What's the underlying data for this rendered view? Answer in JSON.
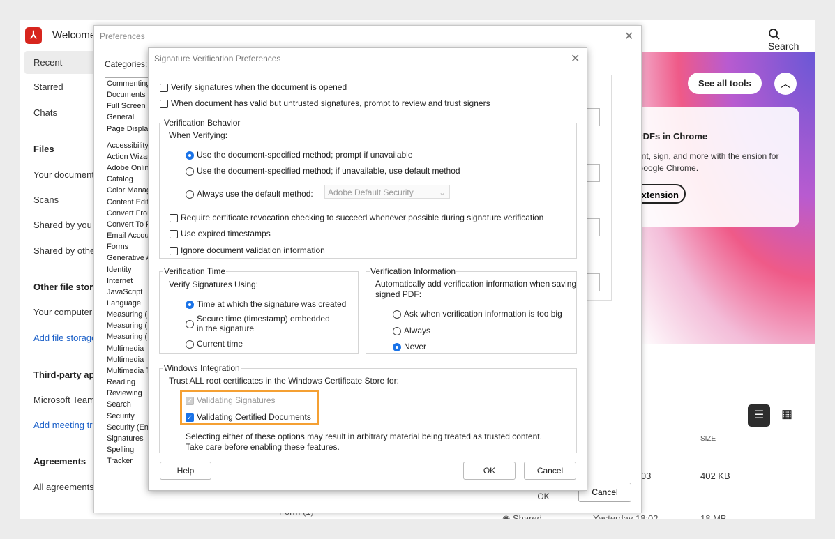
{
  "app": {
    "welcome": "Welcome",
    "search_label": "Search",
    "sidebar": [
      {
        "label": "Recent",
        "type": "item",
        "selected": true
      },
      {
        "label": "Starred",
        "type": "item"
      },
      {
        "label": "Chats",
        "type": "item"
      },
      {
        "label": "Files",
        "type": "head"
      },
      {
        "label": "Your document",
        "type": "item"
      },
      {
        "label": "Scans",
        "type": "item"
      },
      {
        "label": "Shared by you",
        "type": "item"
      },
      {
        "label": "Shared by othe",
        "type": "item"
      },
      {
        "label": "Other file stora",
        "type": "head"
      },
      {
        "label": "Your computer",
        "type": "item"
      },
      {
        "label": "Add file storage",
        "type": "link"
      },
      {
        "label": "Third-party app",
        "type": "head"
      },
      {
        "label": "Microsoft Team",
        "type": "item"
      },
      {
        "label": "Add meeting tr",
        "type": "link"
      },
      {
        "label": "Agreements",
        "type": "head"
      },
      {
        "label": "All agreements",
        "type": "item"
      }
    ],
    "see_all_tools": "See all tools",
    "promo_title": "PDFs in Chrome",
    "promo_text": "ent, sign, and more with the ension for Google Chrome.",
    "promo_button": "xtension",
    "size_header": "SIZE",
    "row1_time": "3:03",
    "row1_size": "402 KB",
    "row2_name": "Form (1)",
    "row2_shared": "Shared",
    "row2_time": "Yesterday 18:02",
    "row2_size": "18 MB"
  },
  "preferences": {
    "title": "Preferences",
    "categories_label": "Categories:",
    "top_categories": [
      "Commenting",
      "Documents",
      "Full Screen",
      "General",
      "Page Display"
    ],
    "categories": [
      "Accessibility",
      "Action Wizar",
      "Adobe Onlin",
      "Catalog",
      "Color Manag",
      "Content Edit",
      "Convert Fron",
      "Convert To P",
      "Email Accou",
      "Forms",
      "Generative A",
      "Identity",
      "Internet",
      "JavaScript",
      "Language",
      "Measuring (",
      "Measuring (",
      "Measuring (",
      "Multimedia",
      "Multimedia",
      "Multimedia T",
      "Reading",
      "Reviewing",
      "Search",
      "Security",
      "Security (En",
      "Signatures",
      "Spelling",
      "Tracker"
    ],
    "ok_label": "OK",
    "cancel_label": "Cancel"
  },
  "dialog": {
    "title": "Signature Verification Preferences",
    "verify_on_open": "Verify signatures when the document is opened",
    "prompt_untrusted": "When document has valid but untrusted signatures, prompt to review and trust signers",
    "behavior_title": "Verification Behavior",
    "when_verifying": "When Verifying:",
    "method_prompt": "Use the document-specified method; prompt if unavailable",
    "method_default": "Use the document-specified method; if unavailable, use default method",
    "method_always": "Always use the default method:",
    "default_method_value": "Adobe Default Security",
    "require_revocation": "Require certificate revocation checking to succeed whenever possible during signature verification",
    "use_expired": "Use expired timestamps",
    "ignore_validation": "Ignore document validation information",
    "time_title": "Verification Time",
    "verify_using": "Verify Signatures Using:",
    "time_created": "Time at which the signature was created",
    "time_secure_1": "Secure time (timestamp) embedded",
    "time_secure_2": "in the signature",
    "time_current": "Current time",
    "info_title": "Verification Information",
    "info_desc_1": "Automatically add verification information when saving",
    "info_desc_2": "signed PDF:",
    "info_ask": "Ask when verification information is too big",
    "info_always": "Always",
    "info_never": "Never",
    "windows_title": "Windows Integration",
    "trust_all": "Trust ALL root certificates in the Windows Certificate Store for:",
    "validating_signatures": "Validating Signatures",
    "validating_certified": "Validating Certified Documents",
    "warning_1": "Selecting either of these options may result in arbitrary material being treated as trusted content.",
    "warning_2": "Take care before enabling these features.",
    "help_label": "Help",
    "ok_label": "OK",
    "cancel_label": "Cancel"
  },
  "colors": {
    "accent": "#1a73e8",
    "highlight": "#f5a033",
    "brand": "#d7251d"
  }
}
